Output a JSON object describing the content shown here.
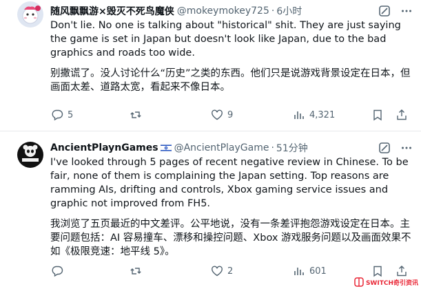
{
  "tweets": [
    {
      "name": "随风飘飘游×毁灭不死鸟魔侠",
      "handle": "@mokeymokey725",
      "time": "6小时",
      "paragraphs": [
        "Don't lie. No one is talking about \"historical\" shit. They are just saying the game is set in Japan but doesn't look like Japan, due to the bad graphics and roads too wide.",
        "别撒谎了。没人讨论什么“历史”之类的东西。他们只是说游戏背景设定在日本，但画面太差、道路太宽，看起来不像日本。"
      ],
      "replies": "5",
      "retweets": "",
      "likes": "9",
      "views": "4,321"
    },
    {
      "name": "AncientPlaynGames",
      "handle": "@AncientPlayGame",
      "time": "51分钟",
      "paragraphs": [
        "I've looked through 5 pages of recent negative review in Chinese. To be fair, none of them is complaining the Japan setting. Top reasons are ramming AIs, drifting and controls, Xbox gaming service issues and graphic not improved from FH5.",
        "我浏览了五页最近的中文差评。公平地说，没有一条差评抱怨游戏设定在日本。主要问题包括：AI 容易撞车、漂移和操控问题、Xbox 游戏服务问题以及画面效果不如《极限竞速：地平线 5》。"
      ],
      "replies": "",
      "retweets": "",
      "likes": "2",
      "views": "601"
    }
  ],
  "watermark": {
    "text": "SWITCH奇引资讯"
  },
  "icons": [
    "grok-icon",
    "more-icon",
    "reply-icon",
    "retweet-icon",
    "like-icon",
    "views-icon",
    "bookmark-icon",
    "share-icon",
    "israel-flag-icon"
  ],
  "colors": {
    "text": "#0f1419",
    "secondary": "#536471",
    "divider": "#e6e9ec",
    "watermark": "#e60012"
  }
}
